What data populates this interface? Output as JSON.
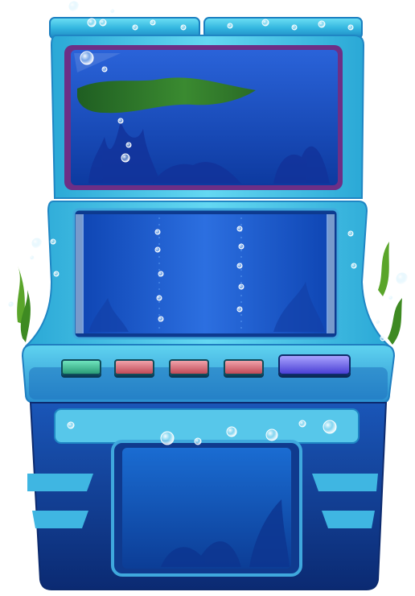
{
  "machine": {
    "theme": "underwater",
    "colors": {
      "frame_cyan": "#3fc6e6",
      "frame_dark": "#0f3f86",
      "screen_blue": "#1d4fc9",
      "reel_blue": "#1b5cd0",
      "weed_green": "#2e7a2a",
      "top_screen_border": "#7a2f8c"
    },
    "buttons": [
      {
        "name": "green",
        "color": "#3fb58e"
      },
      {
        "name": "red-1",
        "color": "#d5626f"
      },
      {
        "name": "red-2",
        "color": "#d5626f"
      },
      {
        "name": "red-3",
        "color": "#d5626f"
      },
      {
        "name": "spin",
        "color": "#6a5ee8"
      }
    ],
    "reels": 3
  }
}
